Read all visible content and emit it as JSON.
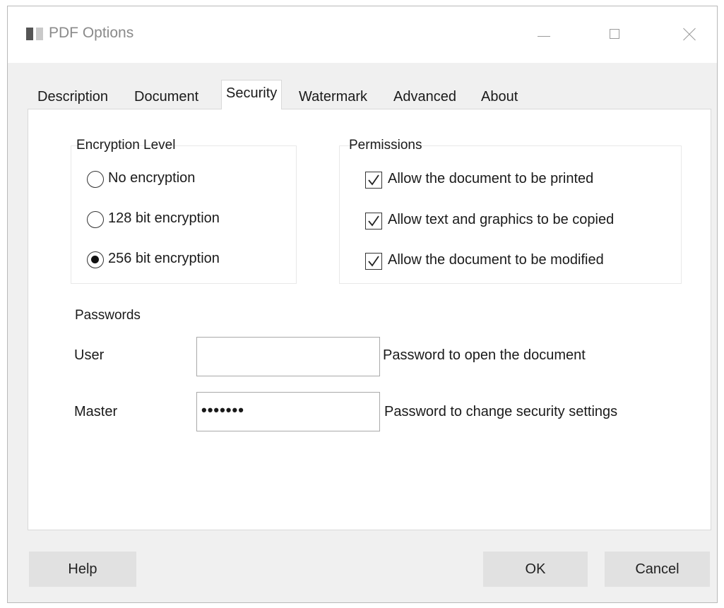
{
  "window": {
    "title": "PDF Options",
    "controls": {
      "minimize_icon": "minimize-icon",
      "maximize_icon": "maximize-icon",
      "close_icon": "close-icon"
    }
  },
  "tabs": [
    {
      "label": "Description",
      "active": false
    },
    {
      "label": "Document",
      "active": false
    },
    {
      "label": "Security",
      "active": true
    },
    {
      "label": "Watermark",
      "active": false
    },
    {
      "label": "Advanced",
      "active": false
    },
    {
      "label": "About",
      "active": false
    }
  ],
  "encryption": {
    "label": "Encryption Level",
    "options": [
      {
        "label": "No encryption",
        "selected": false
      },
      {
        "label": "128 bit encryption",
        "selected": false
      },
      {
        "label": "256 bit encryption",
        "selected": true
      }
    ]
  },
  "permissions": {
    "label": "Permissions",
    "items": [
      {
        "label": "Allow the document to be printed",
        "checked": true
      },
      {
        "label": "Allow text and graphics to be copied",
        "checked": true
      },
      {
        "label": "Allow the document to be modified",
        "checked": true
      }
    ]
  },
  "passwords": {
    "label": "Passwords",
    "user": {
      "label": "User",
      "value": "",
      "description": "Password to open the document"
    },
    "master": {
      "label": "Master",
      "value": "•••••••",
      "description": "Password to change security settings"
    }
  },
  "buttons": {
    "help": "Help",
    "ok": "OK",
    "cancel": "Cancel"
  }
}
